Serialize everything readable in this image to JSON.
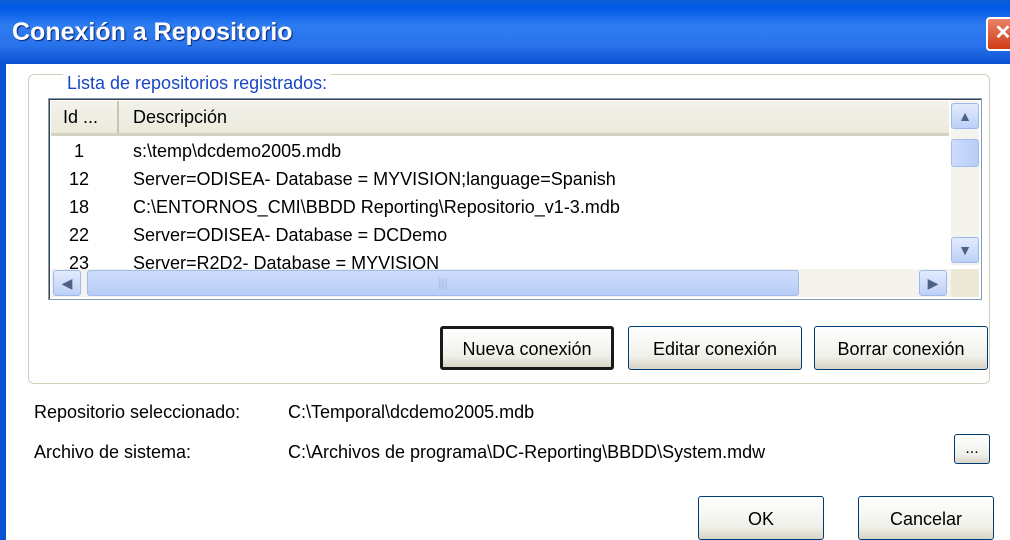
{
  "window": {
    "title": "Conexión a Repositorio",
    "close_glyph": "✕"
  },
  "group": {
    "legend": "Lista de repositorios registrados:"
  },
  "list": {
    "columns": [
      "Id ...",
      "Descripción"
    ],
    "rows": [
      {
        "id": "1",
        "desc": "s:\\temp\\dcdemo2005.mdb"
      },
      {
        "id": "12",
        "desc": "Server=ODISEA- Database = MYVISION;language=Spanish"
      },
      {
        "id": "18",
        "desc": "C:\\ENTORNOS_CMI\\BBDD Reporting\\Repositorio_v1-3.mdb"
      },
      {
        "id": "22",
        "desc": "Server=ODISEA- Database = DCDemo"
      },
      {
        "id": "23",
        "desc": "Server=R2D2- Database = MYVISION"
      }
    ]
  },
  "buttons": {
    "new": "Nueva conexión",
    "edit": "Editar conexión",
    "delete": "Borrar conexión",
    "browse": "...",
    "ok": "OK",
    "cancel": "Cancelar"
  },
  "fields": {
    "selected_label": "Repositorio seleccionado:",
    "selected_value": "C:\\Temporal\\dcdemo2005.mdb",
    "system_label": "Archivo de sistema:",
    "system_value": "C:\\Archivos de programa\\DC-Reporting\\BBDD\\System.mdw"
  },
  "icons": {
    "scroll_up": "scroll-up-arrow-icon",
    "scroll_down": "scroll-down-arrow-icon",
    "scroll_left": "scroll-left-arrow-icon",
    "scroll_right": "scroll-right-arrow-icon"
  },
  "colors": {
    "title_bar": "#2a73ec",
    "legend": "#1a47c8",
    "window_bg": "#ffffff"
  }
}
